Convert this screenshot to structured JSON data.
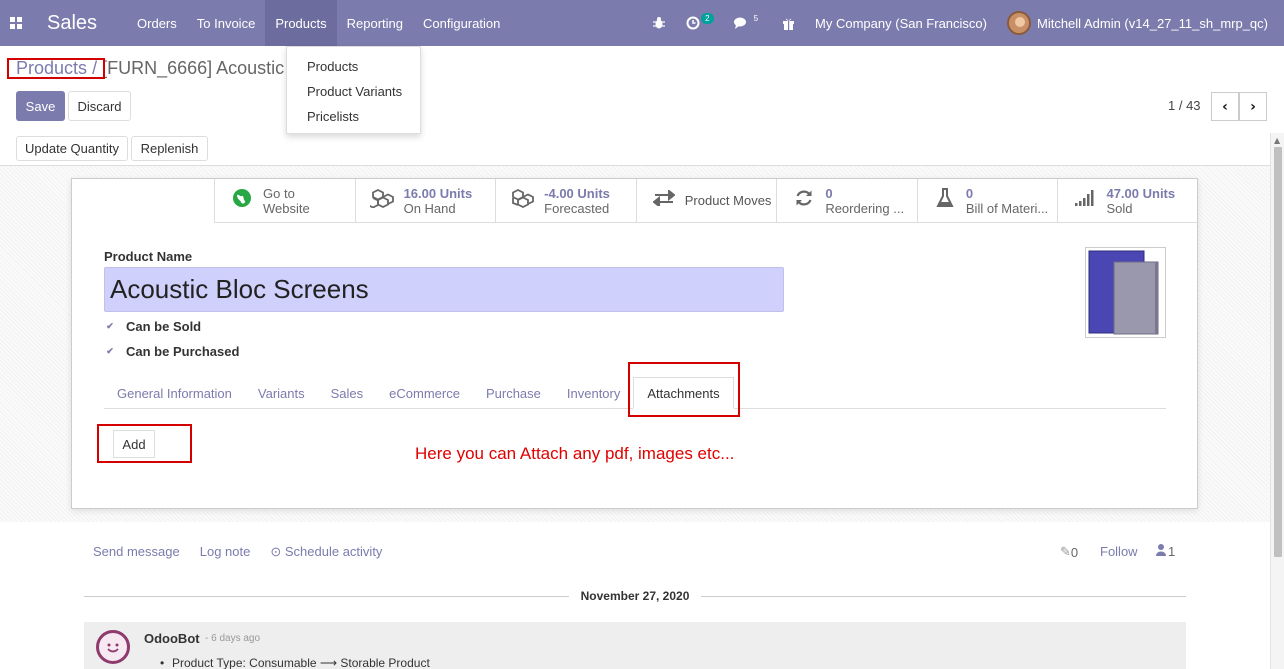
{
  "navbar": {
    "brand": "Sales",
    "menu": [
      "Orders",
      "To Invoice",
      "Products",
      "Reporting",
      "Configuration"
    ],
    "activity_badge": "2",
    "message_badge": "5",
    "company": "My Company (San Francisco)",
    "user": "Mitchell Admin (v14_27_11_sh_mrp_qc)"
  },
  "dropdown": {
    "items": [
      "Products",
      "Product Variants",
      "Pricelists"
    ]
  },
  "breadcrumb": {
    "parent": "Products",
    "separator": "/",
    "current": "[FURN_6666] Acoustic"
  },
  "buttons": {
    "save": "Save",
    "discard": "Discard",
    "update_quantity": "Update Quantity",
    "replenish": "Replenish",
    "add": "Add"
  },
  "pager": {
    "text": "1 / 43",
    "prev": "‹",
    "next": "›"
  },
  "smart_buttons": [
    {
      "line1": "Go to",
      "line2": "Website"
    },
    {
      "value": "16.00 Units",
      "label": "On Hand"
    },
    {
      "value": "-4.00 Units",
      "label": "Forecasted"
    },
    {
      "single": "Product Moves"
    },
    {
      "value": "0",
      "label": "Reordering ..."
    },
    {
      "value": "0",
      "label": "Bill of Materi..."
    },
    {
      "value": "47.00 Units",
      "label": "Sold"
    }
  ],
  "form": {
    "name_label": "Product Name",
    "name_value": "Acoustic Bloc Screens",
    "can_be_sold": "Can be Sold",
    "can_be_purchased": "Can be Purchased"
  },
  "tabs": [
    "General Information",
    "Variants",
    "Sales",
    "eCommerce",
    "Purchase",
    "Inventory",
    "Attachments"
  ],
  "annotation": "Here you can Attach any pdf, images etc...",
  "chatter": {
    "send_message": "Send message",
    "log_note": "Log note",
    "schedule_activity": "Schedule activity",
    "attachments_count": "0",
    "follow": "Follow",
    "followers_count": "1",
    "date": "November 27, 2020",
    "author": "OdooBot",
    "time": "- 6 days ago",
    "body": "Product Type: Consumable ⟶ Storable Product"
  },
  "colors": {
    "navbar": "#7c7bad",
    "accent": "#7c7bad",
    "annotation": "#e00000",
    "input_bg": "#d0d0fc"
  }
}
